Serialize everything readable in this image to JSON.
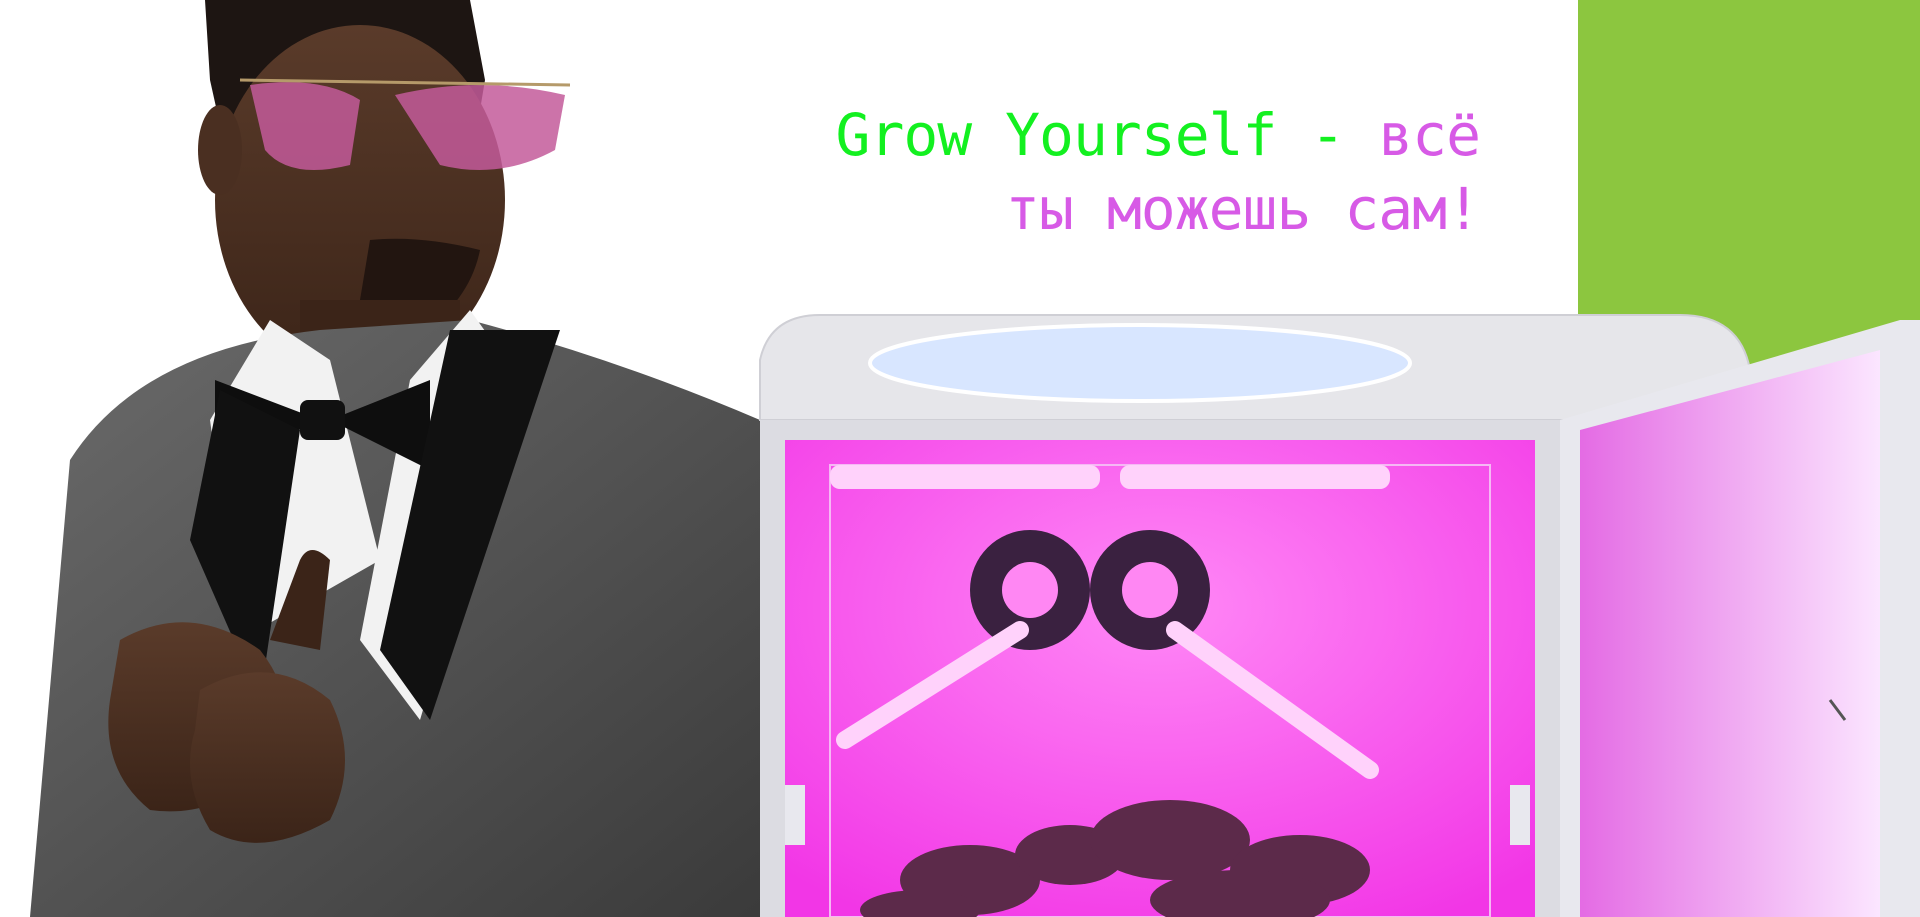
{
  "headline": {
    "part_green": "Grow Yourself - ",
    "part_pink_1": "всё",
    "part_pink_2": "ты можешь сам!"
  },
  "colors": {
    "accent_green": "#13f020",
    "accent_pink": "#d75ae6",
    "panel_green": "#8cc63f",
    "grow_light": "#ff3df0"
  },
  "images": {
    "person": "man-in-tuxedo-with-pink-sunglasses",
    "product": "smart-grow-box-with-pink-led-light"
  }
}
